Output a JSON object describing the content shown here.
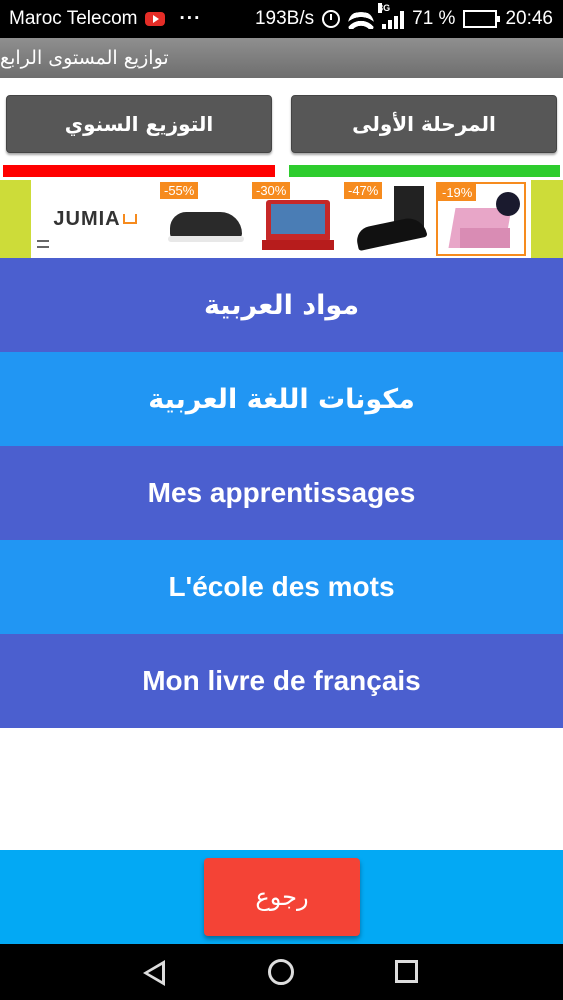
{
  "status_bar": {
    "carrier": "Maroc Telecom",
    "more": "···",
    "net_speed": "193B/s",
    "net_type": "3G",
    "battery_percent": "71 %",
    "battery_level": 0.71,
    "time": "20:46"
  },
  "header": {
    "title": "توازيع المستوى الرابع"
  },
  "top_buttons": {
    "annual": "التوزيع السنوي",
    "phase_one": "المرحلة الأولى"
  },
  "indicators": {
    "left_color": "#ff0000",
    "right_color": "#2ecc2e"
  },
  "ad": {
    "brand": "JUMIA",
    "items": [
      {
        "discount": "-55%",
        "product": "shoe"
      },
      {
        "discount": "-30%",
        "product": "keyboard-case"
      },
      {
        "discount": "-47%",
        "product": "dark-shoe"
      },
      {
        "discount": "-19%",
        "product": "tablet-case"
      }
    ]
  },
  "menu": {
    "items": [
      {
        "label": "مواد العربية"
      },
      {
        "label": "مكونات اللغة العربية"
      },
      {
        "label": "Mes apprentissages"
      },
      {
        "label": "L'école des mots"
      },
      {
        "label": "Mon livre de français"
      }
    ]
  },
  "footer": {
    "back_label": "رجوع"
  },
  "colors": {
    "menu_dark": "#4b5fcf",
    "menu_light": "#2196f3",
    "footer_bg": "#03a9f4",
    "back_button": "#f44336",
    "ad_border": "#cddc39",
    "badge": "#f68b1e"
  }
}
